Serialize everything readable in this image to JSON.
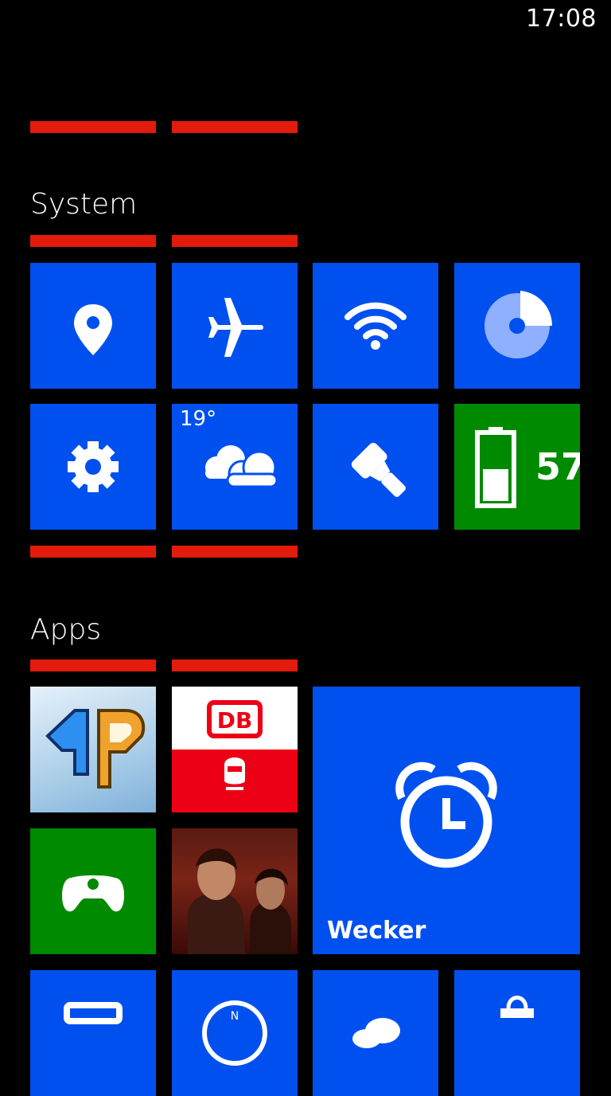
{
  "status_bar": {
    "time": "17:08"
  },
  "sections": {
    "system": {
      "title": "System"
    },
    "apps": {
      "title": "Apps"
    }
  },
  "tiles": {
    "weather": {
      "temperature": "19°"
    },
    "battery": {
      "level": "57"
    },
    "alarm": {
      "label": "Wecker"
    }
  },
  "colors": {
    "accent_blue": "#0050ef",
    "green": "#008a00",
    "red_marker": "#e31b0c"
  }
}
